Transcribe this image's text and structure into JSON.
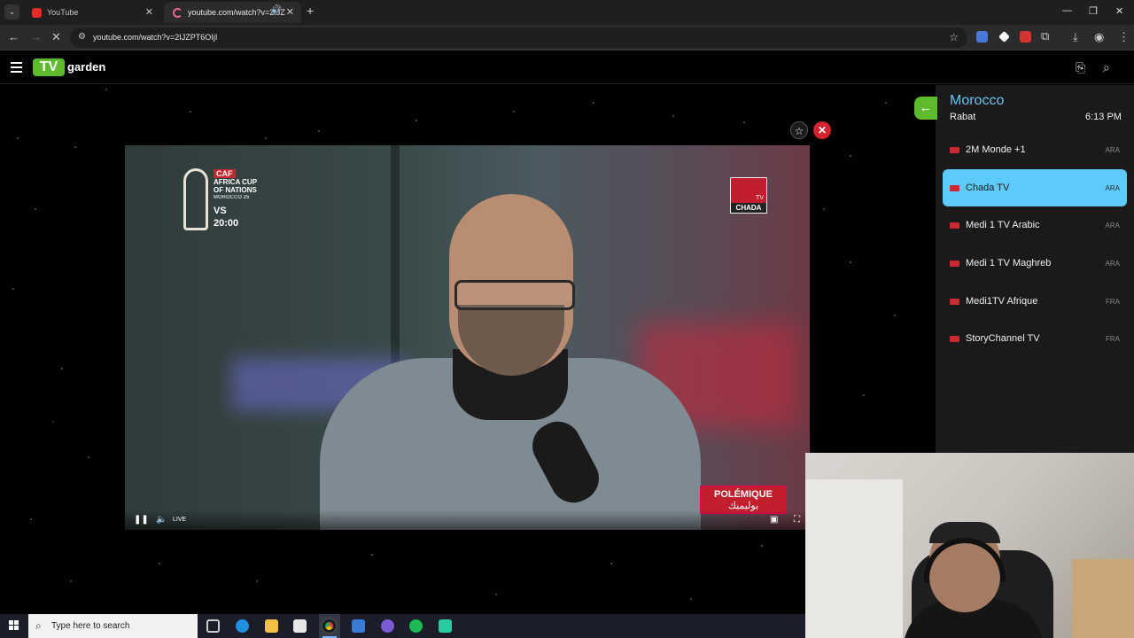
{
  "browser": {
    "tabs": [
      {
        "title": "YouTube",
        "active": false
      },
      {
        "title": "youtube.com/watch?v=2IJZ",
        "active": true
      }
    ],
    "url": "youtube.com/watch?v=2IJZPT6OIjI"
  },
  "app": {
    "logo_badge": "TV",
    "logo_word": "garden"
  },
  "panel": {
    "country": "Morocco",
    "city": "Rabat",
    "time": "6:13 PM",
    "channels": [
      {
        "name": "2M Monde +1",
        "lang": "ARA",
        "active": false
      },
      {
        "name": "Chada TV",
        "lang": "ARA",
        "active": true
      },
      {
        "name": "Medi 1 TV Arabic",
        "lang": "ARA",
        "active": false
      },
      {
        "name": "Medi 1 TV Maghreb",
        "lang": "ARA",
        "active": false
      },
      {
        "name": "Medi1TV Afrique",
        "lang": "FRA",
        "active": false
      },
      {
        "name": "StoryChannel TV",
        "lang": "FRA",
        "active": false
      }
    ]
  },
  "video": {
    "live_label": "LIVE",
    "overlay": {
      "caf_badge": "CAF",
      "caf_line1": "AFRICA CUP",
      "caf_line2": "OF NATIONS",
      "caf_line3": "MOROCCO 25",
      "vs": "VS",
      "match_time": "20:00",
      "channel_logo": "CHADA",
      "channel_logo_sub": "TV",
      "show_fr": "POLÉMIQUE",
      "show_ar": "بوليميك"
    }
  },
  "taskbar": {
    "search_placeholder": "Type here to search"
  },
  "colors": {
    "accent_green": "#5dbb2c",
    "accent_blue": "#62c6f5",
    "active_channel": "#5ccbf9",
    "close_red": "#d4232c"
  }
}
